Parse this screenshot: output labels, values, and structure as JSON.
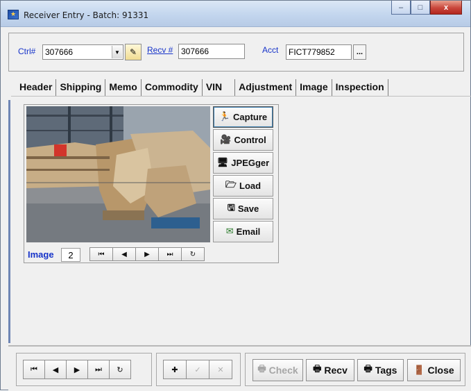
{
  "window": {
    "title": "Receiver Entry - Batch: 91331",
    "minimize": "–",
    "maximize": "□",
    "close": "x"
  },
  "header": {
    "ctrl_label": "Ctrl#",
    "ctrl_value": "307666",
    "recv_label": "Recv #",
    "recv_value": "307666",
    "acct_label": "Acct",
    "acct_value": "FICT779852",
    "acct_lookup": "..."
  },
  "tabs": [
    "Header",
    "Shipping",
    "Memo",
    "Commodity",
    "VIN",
    "Adjustment",
    "Image",
    "Inspection"
  ],
  "active_tab": "Image",
  "image_panel": {
    "buttons": [
      "Capture",
      "Control",
      "JPEGger",
      "Load",
      "Save",
      "Email"
    ],
    "image_label": "Image",
    "image_number": "2",
    "nav": [
      "⏮",
      "◀",
      "▶",
      "⏭",
      "↻"
    ]
  },
  "bottom": {
    "nav": [
      "⏮",
      "◀",
      "▶",
      "⏭",
      "↻"
    ],
    "edit": [
      "✚",
      "✓",
      "✕"
    ],
    "check_label": "Check",
    "recv_label": "Recv",
    "tags_label": "Tags",
    "close_label": "Close"
  }
}
